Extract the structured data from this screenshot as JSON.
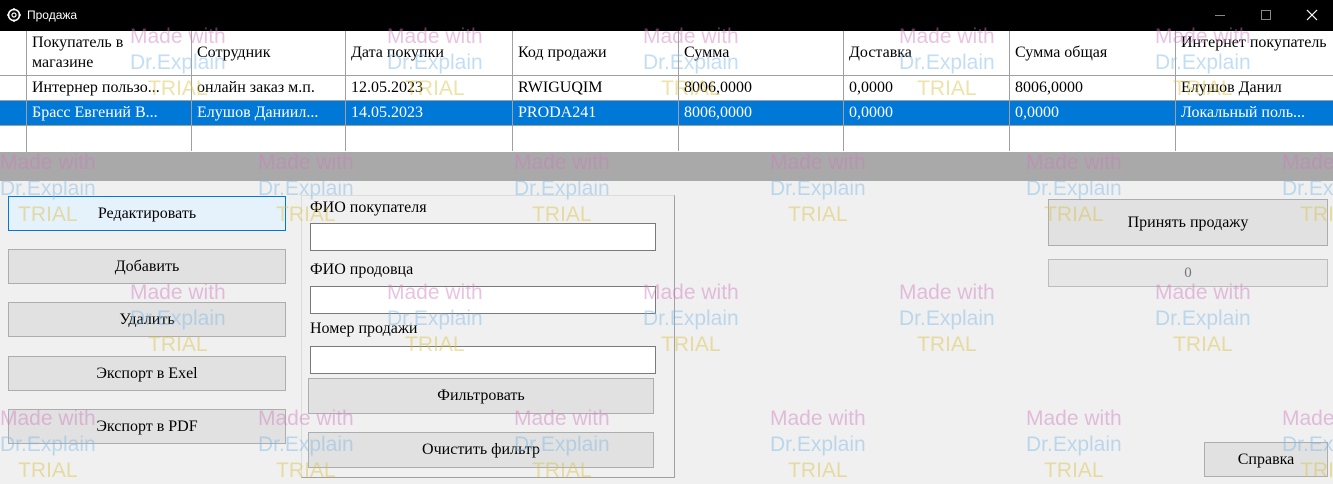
{
  "window": {
    "title": "Продажа",
    "icon": "gear-icon",
    "controls": [
      "minimize-icon",
      "maximize-icon",
      "close-icon"
    ]
  },
  "grid": {
    "columns": [
      "Покупатель в магазине",
      "Сотрудник",
      "Дата покупки",
      "Код продажи",
      "Сумма",
      "Доставка",
      "Сумма общая",
      "Интернет покупатель"
    ],
    "rows": [
      [
        "Интернер пользо...",
        "онлайн заказ м.п.",
        "12.05.2023",
        "RWIGUQIM",
        "8006,0000",
        "0,0000",
        "8006,0000",
        "Елушов Данил"
      ],
      [
        "Брасс Евгений В...",
        "Елушов Даниил...",
        "14.05.2023",
        "PRODA241",
        "8006,0000",
        "0,0000",
        "0,0000",
        "Локальный поль..."
      ]
    ],
    "selected_row": 1
  },
  "buttons": {
    "edit": "Редактировать",
    "add": "Добавить",
    "delete": "Удалить",
    "export_excel": "Экспорт в Exel",
    "export_pdf": "Экспорт в PDF",
    "filter": "Фильтровать",
    "clear_filter": "Очистить фильтр",
    "accept_sale": "Принять продажу",
    "help": "Справка"
  },
  "filter": {
    "buyer_label": "ФИО покупателя",
    "buyer_value": "",
    "seller_label": "ФИО продовца",
    "seller_value": "",
    "number_label": "Номер продажи",
    "number_value": ""
  },
  "progress": {
    "text": "0",
    "value": 0
  },
  "watermark": {
    "line1": "Made with",
    "line2": "Dr.Explain",
    "line3": "TRIAL"
  },
  "colors": {
    "selection": "#0078d7",
    "titlebar": "#000000"
  }
}
